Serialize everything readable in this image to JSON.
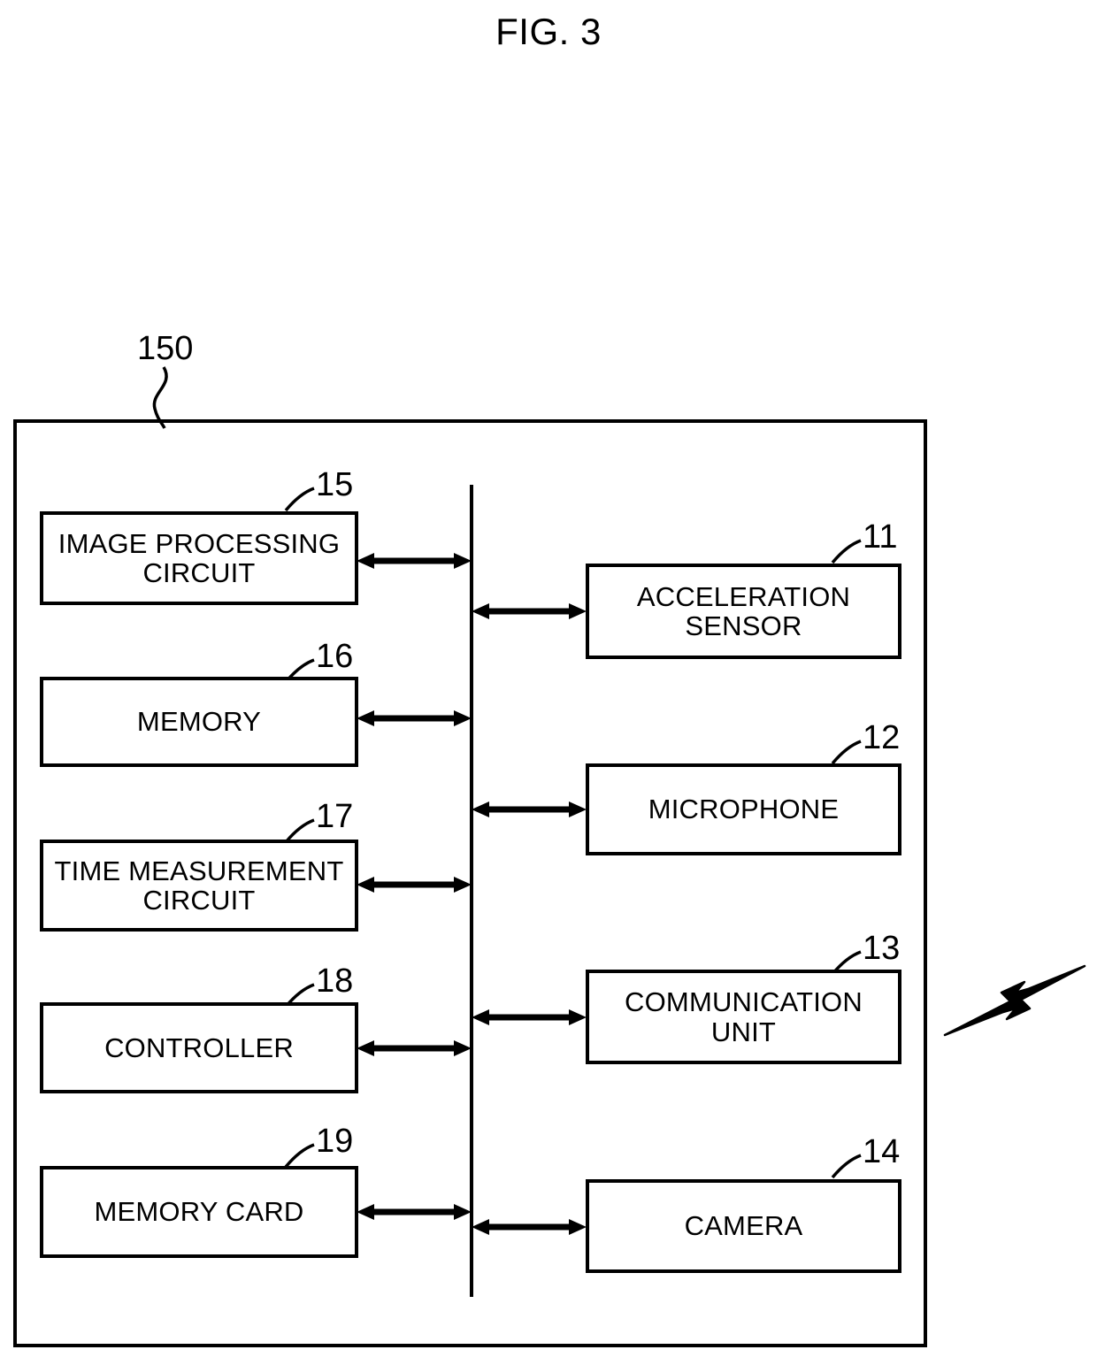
{
  "figure": {
    "title": "FIG. 3",
    "device_ref": "150"
  },
  "diagram": {
    "type": "block-diagram",
    "bus_label": "",
    "left_blocks": [
      {
        "ref": "15",
        "label": "IMAGE PROCESSING\nCIRCUIT"
      },
      {
        "ref": "16",
        "label": "MEMORY"
      },
      {
        "ref": "17",
        "label": "TIME MEASUREMENT\nCIRCUIT"
      },
      {
        "ref": "18",
        "label": "CONTROLLER"
      },
      {
        "ref": "19",
        "label": "MEMORY CARD"
      }
    ],
    "right_blocks": [
      {
        "ref": "11",
        "label": "ACCELERATION\nSENSOR"
      },
      {
        "ref": "12",
        "label": "MICROPHONE"
      },
      {
        "ref": "13",
        "label": "COMMUNICATION\nUNIT"
      },
      {
        "ref": "14",
        "label": "CAMERA"
      }
    ],
    "wireless_icon": "lightning-bolt-icon",
    "connection_style": "double-headed-arrow",
    "colors": {
      "stroke": "#000000",
      "background": "#ffffff"
    }
  }
}
